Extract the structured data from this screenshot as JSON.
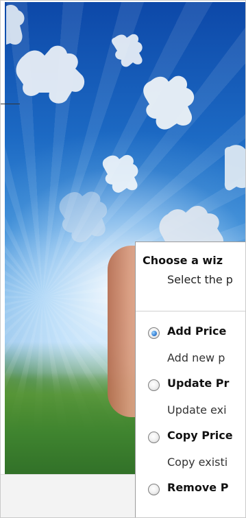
{
  "wizard": {
    "title": "Choose a wiz",
    "subtitle": "Select the p"
  },
  "options": [
    {
      "title": "Add Price",
      "description": "Add new p",
      "selected": true
    },
    {
      "title": "Update Pr",
      "description": "Update exi",
      "selected": false
    },
    {
      "title": "Copy Price",
      "description": "Copy existi",
      "selected": false
    },
    {
      "title": "Remove P",
      "description": "",
      "selected": false
    }
  ],
  "theme": {
    "accent_blue": "#3d86d8",
    "sky_blue": "#1c69c3",
    "grass_green": "#3f842f"
  }
}
